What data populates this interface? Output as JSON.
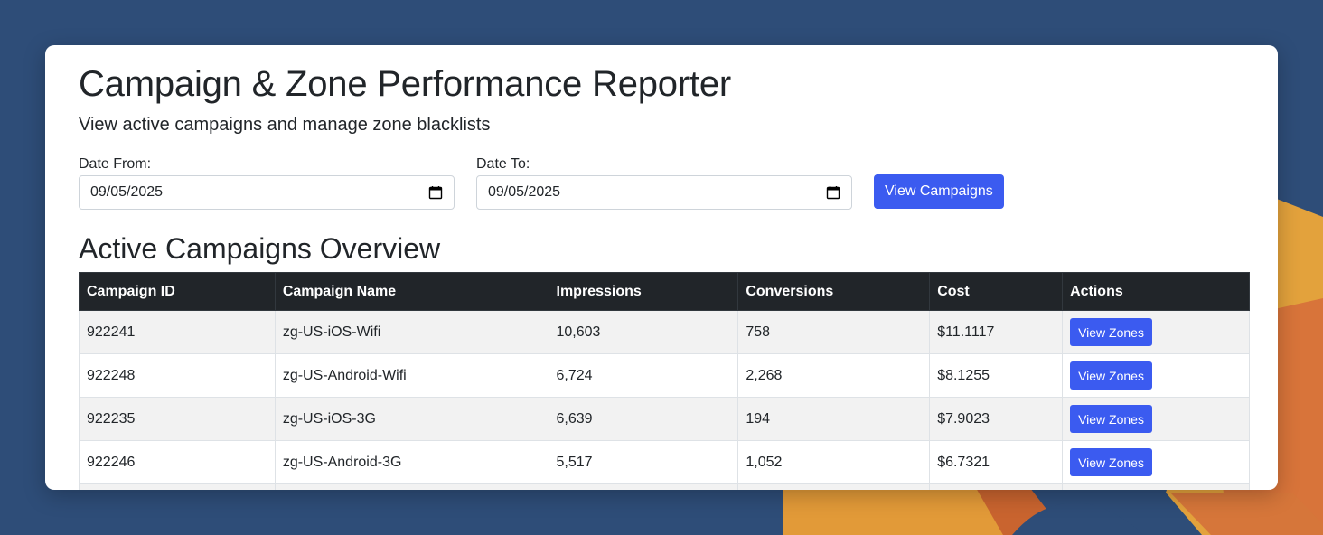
{
  "page": {
    "title": "Campaign & Zone Performance Reporter",
    "subtitle": "View active campaigns and manage zone blacklists"
  },
  "filters": {
    "date_from_label": "Date From:",
    "date_from_value": "09/05/2025",
    "date_to_label": "Date To:",
    "date_to_value": "09/05/2025",
    "view_button_label": "View Campaigns",
    "calendar_icon": "calendar-icon"
  },
  "overview": {
    "heading": "Active Campaigns Overview",
    "columns": [
      "Campaign ID",
      "Campaign Name",
      "Impressions",
      "Conversions",
      "Cost",
      "Actions"
    ],
    "rows": [
      {
        "id": "922241",
        "name": "zg-US-iOS-Wifi",
        "impressions": "10,603",
        "conversions": "758",
        "cost": "$11.1117",
        "action": "View Zones"
      },
      {
        "id": "922248",
        "name": "zg-US-Android-Wifi",
        "impressions": "6,724",
        "conversions": "2,268",
        "cost": "$8.1255",
        "action": "View Zones"
      },
      {
        "id": "922235",
        "name": "zg-US-iOS-3G",
        "impressions": "6,639",
        "conversions": "194",
        "cost": "$7.9023",
        "action": "View Zones"
      },
      {
        "id": "922246",
        "name": "zg-US-Android-3G",
        "impressions": "5,517",
        "conversions": "1,052",
        "cost": "$6.7321",
        "action": "View Zones"
      }
    ]
  },
  "colors": {
    "desktop_background": "#2e4d78",
    "primary_button": "#3b5bf0",
    "table_header": "#212529",
    "stripe": "#f2f2f2"
  }
}
